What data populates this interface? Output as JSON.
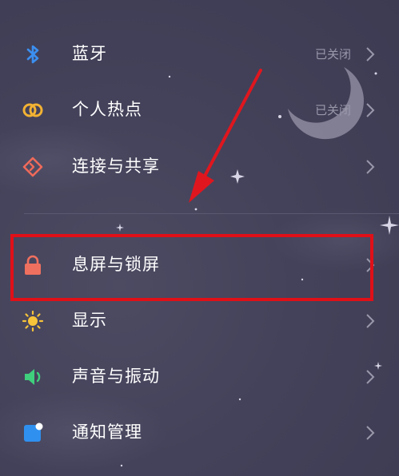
{
  "settings": {
    "items": [
      {
        "label": "蓝牙",
        "status": "已关闭",
        "icon": "bluetooth-icon"
      },
      {
        "label": "个人热点",
        "status": "已关闭",
        "icon": "hotspot-icon"
      },
      {
        "label": "连接与共享",
        "status": "",
        "icon": "connection-sharing-icon"
      },
      {
        "label": "息屏与锁屏",
        "status": "",
        "icon": "lock-icon"
      },
      {
        "label": "显示",
        "status": "",
        "icon": "sun-icon"
      },
      {
        "label": "声音与振动",
        "status": "",
        "icon": "speaker-icon"
      },
      {
        "label": "通知管理",
        "status": "",
        "icon": "notification-icon"
      }
    ]
  },
  "colors": {
    "background": "#44425a",
    "highlight": "#e01018",
    "bluetooth": "#3b8ff0",
    "hotspot": "#f2b233",
    "connection": "#ef6a5a",
    "lock": "#f0705f",
    "display": "#f7c43a",
    "sound": "#3fcf7d",
    "notification": "#2f90f0"
  }
}
